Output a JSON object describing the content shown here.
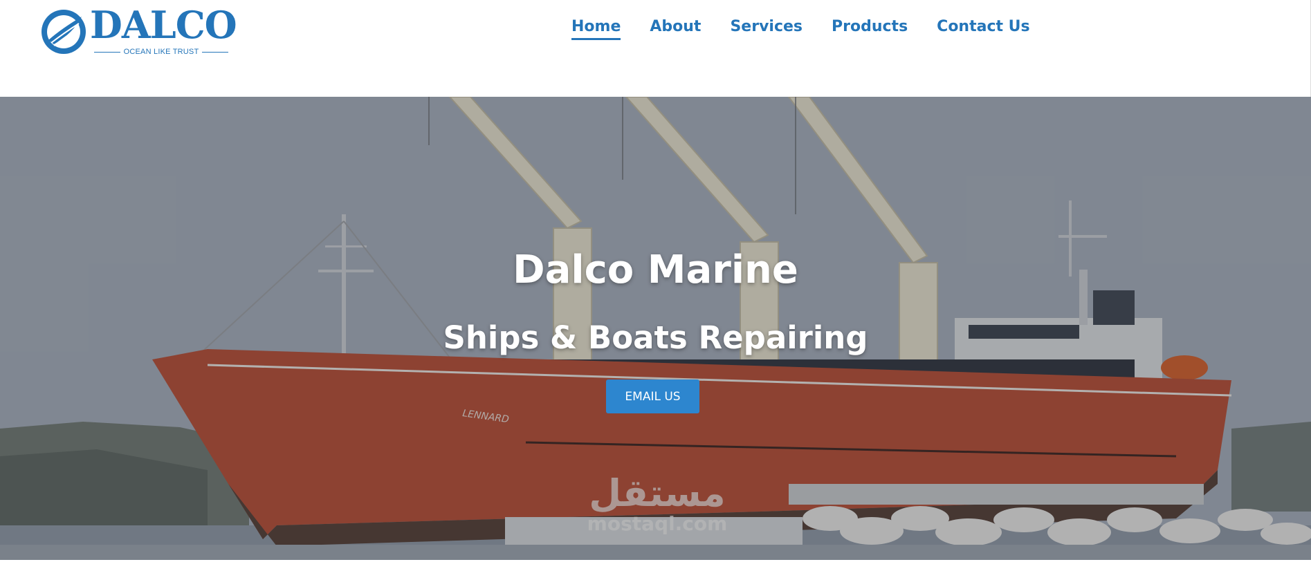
{
  "logo": {
    "name": "DALCO",
    "tagline": "OCEAN LIKE TRUST",
    "icon": "wave-globe-icon"
  },
  "nav": {
    "items": [
      {
        "label": "Home",
        "active": true
      },
      {
        "label": "About"
      },
      {
        "label": "Services"
      },
      {
        "label": "Products"
      },
      {
        "label": "Contact Us"
      }
    ]
  },
  "hero": {
    "title": "Dalco Marine",
    "subtitle": "Ships & Boats Repairing",
    "button_label": "EMAIL US",
    "ship_name": "LENNARD",
    "background": "cargo-ship-docked-photo"
  },
  "watermark": {
    "arabic": "مستقل",
    "latin": "mostaql.com"
  },
  "colors": {
    "brand": "#2475b9",
    "button": "#2d86cf",
    "hull": "#b4482b"
  }
}
